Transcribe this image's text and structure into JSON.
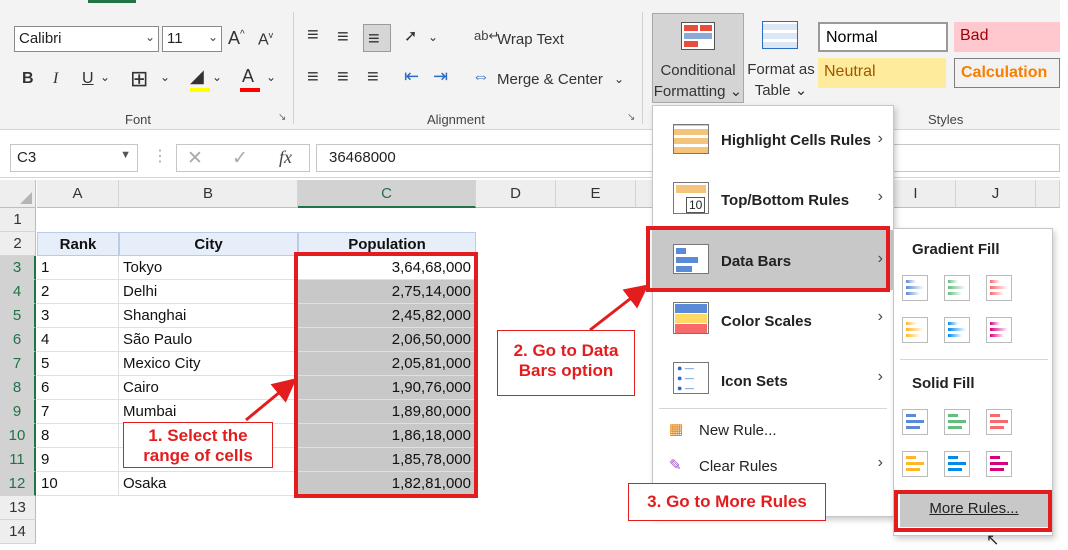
{
  "ribbon": {
    "font_name": "Calibri",
    "font_size": "11",
    "font_group_label": "Font",
    "alignment_group_label": "Alignment",
    "styles_group_label": "Styles",
    "bold": "B",
    "italic": "I",
    "underline": "U",
    "wrap_text": "Wrap Text",
    "merge_center": "Merge & Center",
    "conditional_formatting": [
      "Conditional",
      "Formatting"
    ],
    "format_as_table": [
      "Format as",
      "Table"
    ],
    "styles": [
      {
        "label": "Normal",
        "bg": "#ffffff",
        "color": "#000000"
      },
      {
        "label": "Bad",
        "bg": "#ffc7ce",
        "color": "#9c0006"
      },
      {
        "label": "Neutral",
        "bg": "#ffeb9c",
        "color": "#9c5700"
      },
      {
        "label": "Calculation",
        "bg": "#f2f2f2",
        "color": "#fa7d00"
      }
    ]
  },
  "formula_bar": {
    "name_box": "C3",
    "fx": "fx",
    "value": "36468000"
  },
  "grid": {
    "columns": [
      "A",
      "B",
      "C",
      "D",
      "E",
      "I",
      "J"
    ],
    "rows": [
      "1",
      "2",
      "3",
      "4",
      "5",
      "6",
      "7",
      "8",
      "9",
      "10",
      "11",
      "12",
      "13",
      "14"
    ],
    "headers": {
      "rank": "Rank",
      "city": "City",
      "population": "Population"
    },
    "data": [
      {
        "rank": "1",
        "city": "Tokyo",
        "population": "3,64,68,000"
      },
      {
        "rank": "2",
        "city": "Delhi",
        "population": "2,75,14,000"
      },
      {
        "rank": "3",
        "city": "Shanghai",
        "population": "2,45,82,000"
      },
      {
        "rank": "4",
        "city": "São Paulo",
        "population": "2,06,50,000"
      },
      {
        "rank": "5",
        "city": "Mexico City",
        "population": "2,05,81,000"
      },
      {
        "rank": "6",
        "city": "Cairo",
        "population": "1,90,76,000"
      },
      {
        "rank": "7",
        "city": "Mumbai",
        "population": "1,89,80,000"
      },
      {
        "rank": "8",
        "city": "",
        "population": "1,86,18,000"
      },
      {
        "rank": "9",
        "city": "",
        "population": "1,85,78,000"
      },
      {
        "rank": "10",
        "city": "Osaka",
        "population": "1,82,81,000"
      }
    ]
  },
  "cf_menu": {
    "items": [
      {
        "label": "Highlight Cells Rules",
        "key": "H"
      },
      {
        "label": "Top/Bottom Rules",
        "key": "T"
      },
      {
        "label": "Data Bars",
        "key": "D"
      },
      {
        "label": "Color Scales",
        "key": "S"
      },
      {
        "label": "Icon Sets",
        "key": "I"
      }
    ],
    "new_rule": "New Rule...",
    "clear_rules": "Clear Rules"
  },
  "databars_menu": {
    "gradient_fill": "Gradient Fill",
    "solid_fill": "Solid Fill",
    "more_rules": "More Rules...",
    "bar_colors": [
      "#5b8bd6",
      "#63be7b",
      "#f8696b",
      "#ffb628",
      "#008aef",
      "#d6007b"
    ]
  },
  "annotations": {
    "step1": [
      "1. Select the",
      "range of cells"
    ],
    "step2": [
      "2. Go to Data",
      "Bars option"
    ],
    "step3": "3. Go to More Rules"
  },
  "colors": {
    "accent": "#217346",
    "annotation": "#e31d1d",
    "selection": "#c8c8c8"
  }
}
